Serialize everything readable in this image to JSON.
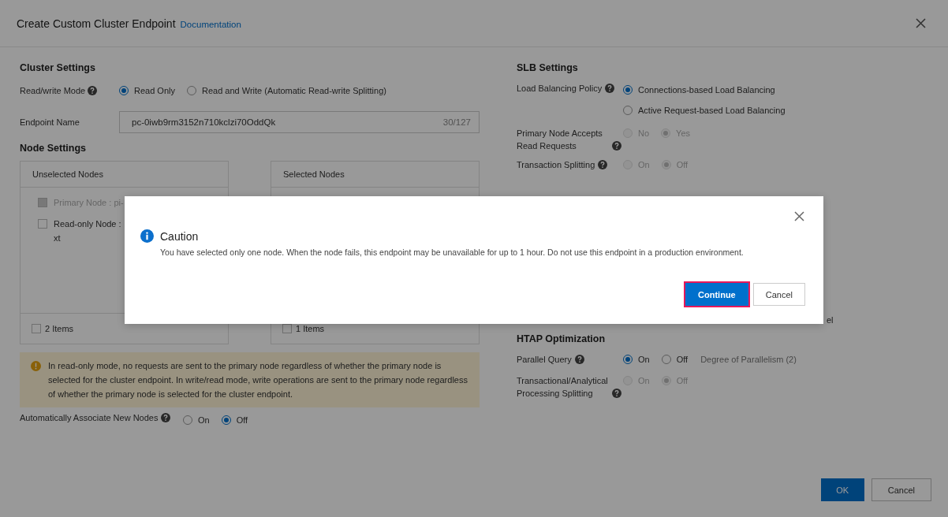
{
  "dialog": {
    "title": "Create Custom Cluster Endpoint",
    "link": "Documentation"
  },
  "cluster_settings": {
    "heading": "Cluster Settings",
    "rows": [
      {
        "kind": "radio",
        "label": "Read/write Mode",
        "help": true,
        "options": [
          {
            "label": "Read Only",
            "selected": true,
            "disabled": false
          },
          {
            "label": "Read and Write (Automatic Read-write Splitting)",
            "selected": false,
            "disabled": false
          }
        ]
      },
      {
        "kind": "input",
        "label": "Endpoint Name",
        "help": false,
        "value": "pc-0iwb9rm3152n710kclzi70OddQk",
        "counter": "30/127"
      }
    ]
  },
  "node_settings": {
    "heading": "Node Settings",
    "unselected": {
      "title": "Unselected Nodes",
      "items": [
        {
          "lines": [
            "Primary Node : pi-"
          ],
          "checked": false,
          "disabled": true
        },
        {
          "lines": [
            "Read-only Node :",
            "xt"
          ],
          "checked": false,
          "disabled": false
        }
      ],
      "footer": "2 Items",
      "footer_checked": false
    },
    "selected": {
      "title": "Selected Nodes",
      "footer": "1 Items",
      "footer_checked": false
    },
    "alert": "In read-only mode, no requests are sent to the primary node regardless of whether the primary node is selected for the cluster endpoint. In write/read mode, write operations are sent to the primary node regardless of whether the primary node is selected for the cluster endpoint.",
    "auto_associate": {
      "label": "Automatically Associate New Nodes",
      "help": true,
      "options": [
        {
          "label": "On",
          "selected": false,
          "disabled": false
        },
        {
          "label": "Off",
          "selected": true,
          "disabled": false
        }
      ]
    }
  },
  "slb_settings": {
    "heading": "SLB Settings",
    "rows": [
      {
        "label": "Load Balancing Policy",
        "help": true,
        "kind": "stacked",
        "options": [
          {
            "label": "Connections-based Load Balancing",
            "selected": true,
            "disabled": false
          },
          {
            "label": "Active Request-based Load Balancing",
            "selected": false,
            "disabled": false
          }
        ]
      },
      {
        "label": "Primary Node Accepts Read Requests",
        "help": true,
        "kind": "inline",
        "options": [
          {
            "label": "No",
            "selected": false,
            "disabled": true
          },
          {
            "label": "Yes",
            "selected": true,
            "disabled": true
          }
        ]
      },
      {
        "label": "Transaction Splitting",
        "help": true,
        "kind": "inline",
        "options": [
          {
            "label": "On",
            "selected": false,
            "disabled": true
          },
          {
            "label": "Off",
            "selected": true,
            "disabled": true
          }
        ]
      }
    ],
    "hidden_fragment": "el"
  },
  "htap_optimization": {
    "heading": "HTAP Optimization",
    "rows": [
      {
        "label": "Parallel Query",
        "help": true,
        "kind": "inline",
        "options": [
          {
            "label": "On",
            "selected": true,
            "disabled": false
          },
          {
            "label": "Off",
            "selected": false,
            "disabled": false
          }
        ],
        "note": "Degree of Parallelism (2)"
      },
      {
        "label": "Transactional/Analytical Processing Splitting",
        "help": true,
        "kind": "inline",
        "options": [
          {
            "label": "On",
            "selected": false,
            "disabled": true
          },
          {
            "label": "Off",
            "selected": true,
            "disabled": true
          }
        ]
      }
    ]
  },
  "footer_buttons": [
    {
      "label": "OK",
      "kind": "primary"
    },
    {
      "label": "Cancel",
      "kind": "default"
    }
  ],
  "caution_modal": {
    "title": "Caution",
    "message": "You have selected only one node. When the node fails, this endpoint may be unavailable for up to 1 hour. Do not use this endpoint in a production environment.",
    "buttons": [
      {
        "label": "Continue",
        "kind": "primary",
        "focused": true
      },
      {
        "label": "Cancel",
        "kind": "default",
        "focused": false
      }
    ]
  }
}
